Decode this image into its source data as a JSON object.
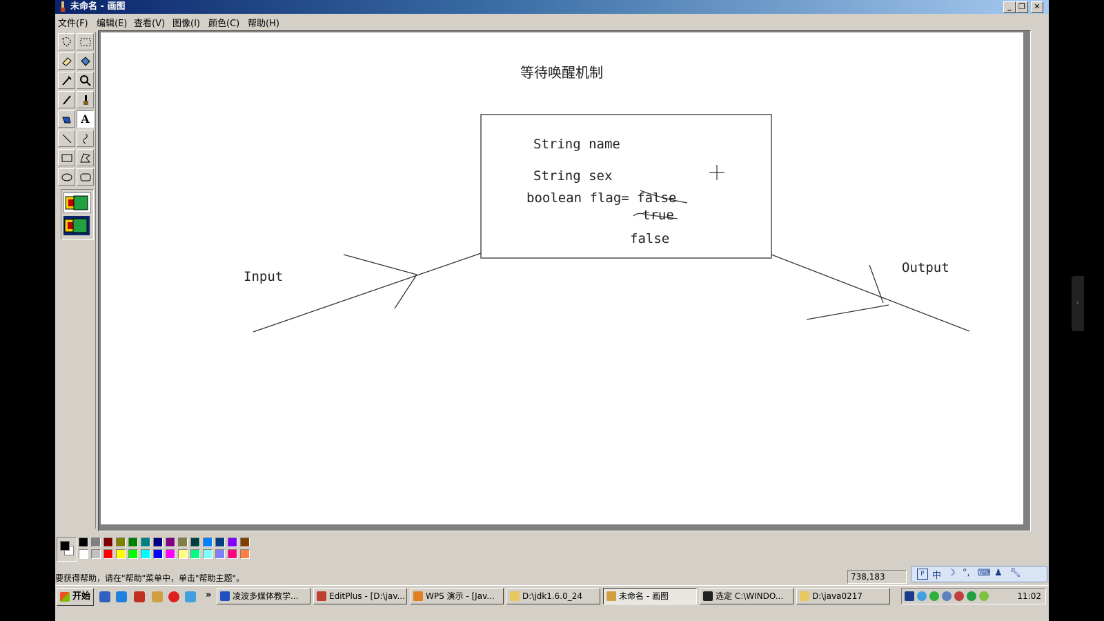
{
  "window": {
    "title": "未命名 - 画图",
    "minimize": "_",
    "restore": "❐",
    "close": "✕"
  },
  "menu": [
    "文件(F)",
    "编辑(E)",
    "查看(V)",
    "图像(I)",
    "颜色(C)",
    "帮助(H)"
  ],
  "canvas": {
    "title": "等待唤醒机制",
    "field_name": "String name",
    "field_sex": "String sex",
    "flag_line": "boolean flag= false",
    "crossed_true": "true",
    "false_again": "false",
    "input_label": "Input",
    "output_label": "Output"
  },
  "palette": {
    "foreground": "#000000",
    "background": "#ffffff",
    "row1": [
      "#000000",
      "#808080",
      "#800000",
      "#808000",
      "#008000",
      "#008080",
      "#000080",
      "#800080",
      "#808040",
      "#004040",
      "#0080ff",
      "#004080",
      "#8000ff",
      "#804000"
    ],
    "row2": [
      "#ffffff",
      "#c0c0c0",
      "#ff0000",
      "#ffff00",
      "#00ff00",
      "#00ffff",
      "#0000ff",
      "#ff00ff",
      "#ffff80",
      "#00ff80",
      "#80ffff",
      "#8080ff",
      "#ff0080",
      "#ff8040"
    ]
  },
  "status": {
    "help": "要获得帮助，请在\"帮助\"菜单中，单击\"帮助主题\"。",
    "coords": "738,183"
  },
  "ime": {
    "mode": "中"
  },
  "taskbar": {
    "start": "开始",
    "more": "»",
    "tasks": [
      {
        "label": "凌波多媒体教学...",
        "color": "#2050c0"
      },
      {
        "label": "EditPlus - [D:\\jav...",
        "color": "#c04030"
      },
      {
        "label": "WPS 演示 - [Jav...",
        "color": "#e08020"
      },
      {
        "label": "D:\\jdk1.6.0_24",
        "color": "#e8c860"
      },
      {
        "label": "未命名 - 画图",
        "color": "#d0a040"
      },
      {
        "label": "选定 C:\\WINDO...",
        "color": "#202020"
      },
      {
        "label": "D:\\java0217",
        "color": "#e8c860"
      }
    ],
    "clock": "11:02"
  }
}
